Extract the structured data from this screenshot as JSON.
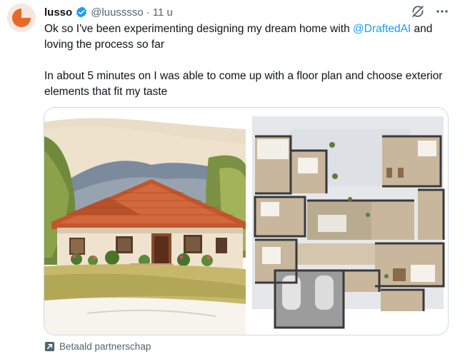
{
  "tweet": {
    "display_name": "lusso",
    "handle": "@luusssso",
    "separator": "·",
    "time": "11 u",
    "text_line1_pre": "Ok so I've been experimenting designing my dream home with ",
    "mention": "@DraftedAI",
    "text_line1_post": " and loving the process so far",
    "text_para2": "In about 5 minutes on I was able to come up with a floor plan and choose exterior elements that fit my taste",
    "promoted_label": "Betaald partnerschap"
  },
  "colors": {
    "accent": "#1d9bf0",
    "avatar_orange": "#e8682b",
    "secondary_text": "#536471"
  },
  "icons": {
    "verified": "verified-badge-icon",
    "grok": "grok-icon",
    "more": "more-icon",
    "promoted": "promoted-arrow-icon"
  }
}
